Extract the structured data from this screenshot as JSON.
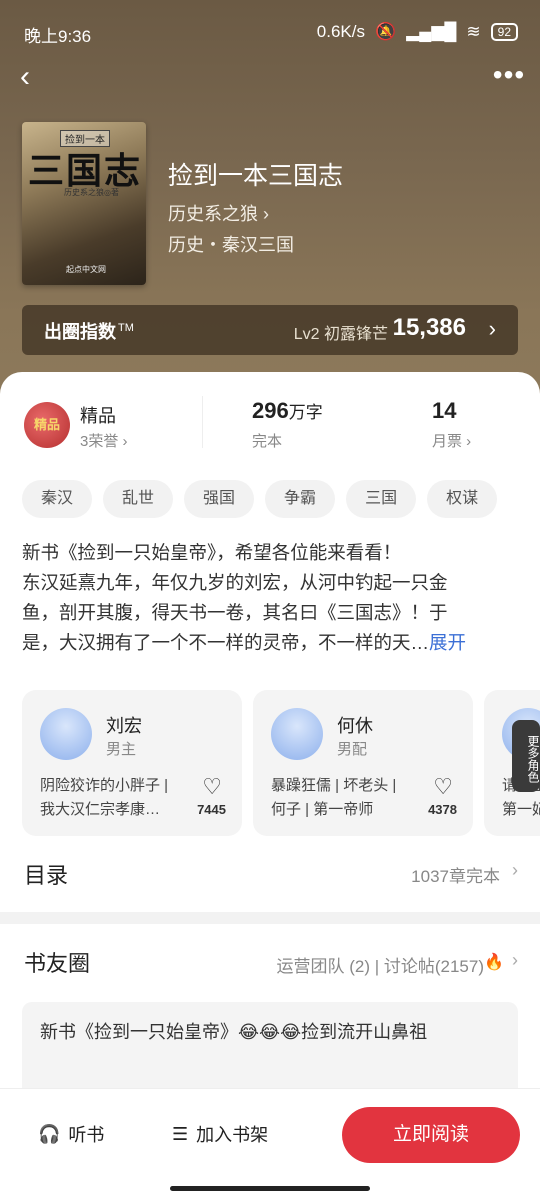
{
  "status": {
    "time": "晚上9:36",
    "speed": "0.6K/s",
    "battery": "92"
  },
  "header": {
    "back_icon": "chevron-left-icon",
    "more_icon": "more-dots-icon"
  },
  "book": {
    "cover_top": "捡到一本",
    "cover_title": "三国志",
    "cover_author": "历史系之狼◎著",
    "cover_publisher": "起点中文网",
    "title": "捡到一本三国志",
    "author": "历史系之狼 ›",
    "genre": "历史・秦汉三国"
  },
  "index": {
    "label": "出圈指数",
    "tm": "TM",
    "level": "Lv2 初露锋芒",
    "value": "15,386"
  },
  "stats": {
    "badge_text": "精品",
    "label": "精品",
    "honor": "3荣誉 ›",
    "words": "296",
    "words_unit": "万字",
    "words_sub": "完本",
    "tickets": "14",
    "tickets_sub": "月票 ›"
  },
  "tags": [
    "秦汉",
    "乱世",
    "强国",
    "争霸",
    "三国",
    "权谋"
  ],
  "description": {
    "line1": "新书《捡到一只始皇帝》，希望各位能来看看！",
    "line2": "东汉延熹九年，年仅九岁的刘宏，从河中钓起一只金",
    "line3": "鱼，剖开其腹，得天书一卷，其名曰《三国志》！于",
    "line4": "是，大汉拥有了一个不一样的灵帝，不一样的天…",
    "expand": "展开"
  },
  "characters": [
    {
      "name": "刘宏",
      "role": "男主",
      "desc1": "阴险狡诈的小胖子 |",
      "desc2": "我大汉仁宗孝康…",
      "likes": "7445"
    },
    {
      "name": "何休",
      "role": "男配",
      "desc1": "暴躁狂儒 | 坏老头 |",
      "desc2": "何子 | 第一帝师",
      "likes": "4378"
    },
    {
      "name": "",
      "role": "",
      "desc1": "请黑王",
      "desc2": "第一妃",
      "likes": ""
    }
  ],
  "more_roles": "更多角色",
  "toc": {
    "title": "目录",
    "count": "1037章完本"
  },
  "circle": {
    "title": "书友圈",
    "ops": "运营团队 (2) | 讨论帖(2157)",
    "post": "新书《捡到一只始皇帝》😂😂😂捡到流开山鼻祖"
  },
  "bottom": {
    "listen": "听书",
    "shelf": "加入书架",
    "read": "立即阅读"
  }
}
